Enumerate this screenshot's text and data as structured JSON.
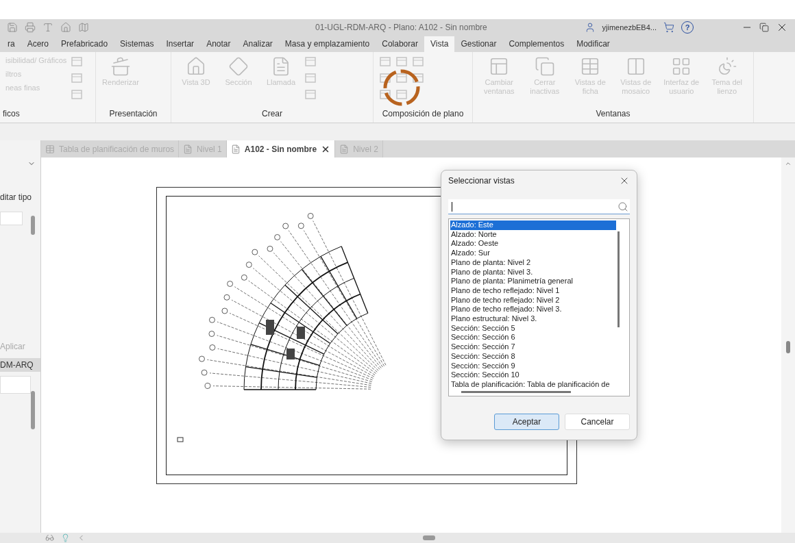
{
  "title_bar": {
    "title": "01-UGL-RDM-ARQ - Plano: A102 - Sin nombre",
    "user": "yjimenezbEB4...",
    "help": "?"
  },
  "ribbon_tabs": [
    {
      "label": "ra",
      "selected": false
    },
    {
      "label": "Acero",
      "selected": false
    },
    {
      "label": "Prefabricado",
      "selected": false
    },
    {
      "label": "Sistemas",
      "selected": false
    },
    {
      "label": "Insertar",
      "selected": false
    },
    {
      "label": "Anotar",
      "selected": false
    },
    {
      "label": "Analizar",
      "selected": false
    },
    {
      "label": "Masa y emplazamiento",
      "selected": false
    },
    {
      "label": "Colaborar",
      "selected": false
    },
    {
      "label": "Vista",
      "selected": true
    },
    {
      "label": "Gestionar",
      "selected": false
    },
    {
      "label": "Complementos",
      "selected": false
    },
    {
      "label": "Modificar",
      "selected": false
    }
  ],
  "ribbon_panels": [
    {
      "kind": "list",
      "title": "ficos",
      "tools": [
        {
          "label": "isibilidad/ Gráficos",
          "disabled": true
        },
        {
          "label": "iltros",
          "disabled": true
        },
        {
          "label": "neas finas",
          "disabled": true
        }
      ]
    },
    {
      "kind": "large",
      "title": "Presentación",
      "tools": [
        {
          "label": "Renderizar",
          "disabled": true
        }
      ]
    },
    {
      "kind": "large",
      "title": "Crear",
      "tools": [
        {
          "label": "Vista 3D",
          "disabled": true
        },
        {
          "label": "Sección",
          "disabled": true
        },
        {
          "label": "Llamada",
          "disabled": true
        }
      ]
    },
    {
      "kind": "grid",
      "title": "Composición de plano"
    },
    {
      "kind": "large",
      "title": "Ventanas",
      "tools": [
        {
          "label": "Cambiar ventanas",
          "disabled": true
        },
        {
          "label": "Cerrar inactivas",
          "disabled": true
        },
        {
          "label": "Vistas de ficha",
          "disabled": true
        },
        {
          "label": "Vistas de mosaico",
          "disabled": true
        },
        {
          "label": "Interfaz de usuario",
          "disabled": true
        },
        {
          "label": "Tema del lienzo",
          "disabled": true
        }
      ]
    }
  ],
  "doc_tabs": [
    {
      "label": "Tabla de planificación de muros",
      "selected": false
    },
    {
      "label": "Nivel 1",
      "selected": false
    },
    {
      "label": "A102 - Sin nombre",
      "selected": true
    },
    {
      "label": "Nivel 2",
      "selected": false
    }
  ],
  "properties": {
    "edit_type": "ditar tipo",
    "apply": "Aplicar",
    "browser_title": "DM-ARQ"
  },
  "dialog": {
    "title": "Seleccionar vistas",
    "items": [
      {
        "label": "Alzado: Este",
        "selected": true
      },
      {
        "label": "Alzado: Norte",
        "selected": false
      },
      {
        "label": "Alzado: Oeste",
        "selected": false
      },
      {
        "label": "Alzado: Sur",
        "selected": false
      },
      {
        "label": "Plano de planta: Nivel 2",
        "selected": false
      },
      {
        "label": "Plano de planta: Nivel 3.",
        "selected": false
      },
      {
        "label": "Plano de planta: Planimetría general",
        "selected": false
      },
      {
        "label": "Plano de techo reflejado: Nivel 1",
        "selected": false
      },
      {
        "label": "Plano de techo reflejado: Nivel 2",
        "selected": false
      },
      {
        "label": "Plano de techo reflejado: Nivel 3.",
        "selected": false
      },
      {
        "label": "Plano estructural: Nivel 3.",
        "selected": false
      },
      {
        "label": "Sección: Sección 5",
        "selected": false
      },
      {
        "label": "Sección: Sección 6",
        "selected": false
      },
      {
        "label": "Sección: Sección 7",
        "selected": false
      },
      {
        "label": "Sección: Sección 8",
        "selected": false
      },
      {
        "label": "Sección: Sección 9",
        "selected": false
      },
      {
        "label": "Sección: Sección 10",
        "selected": false
      },
      {
        "label": "Tabla de planificación: Tabla de planificación de",
        "selected": false
      }
    ],
    "buttons": [
      {
        "label": "Aceptar",
        "kind": "primary"
      },
      {
        "label": "Cancelar",
        "kind": "secondary"
      }
    ]
  }
}
